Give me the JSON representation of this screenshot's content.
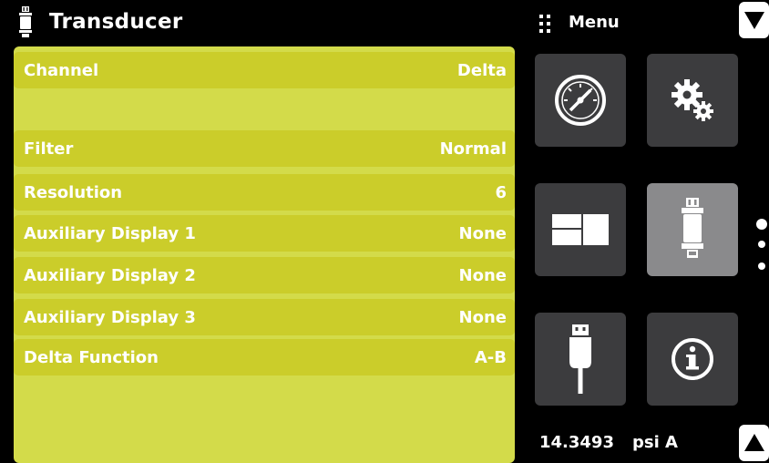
{
  "header": {
    "title": "Transducer",
    "icon": "transducer-icon"
  },
  "menu": {
    "label": "Menu",
    "icon": "grid-icon"
  },
  "settings": [
    {
      "label": "Channel",
      "value": "Delta"
    },
    {
      "label": "Filter",
      "value": "Normal"
    },
    {
      "label": "Resolution",
      "value": "6"
    },
    {
      "label": "Auxiliary Display 1",
      "value": "None"
    },
    {
      "label": "Auxiliary Display 2",
      "value": "None"
    },
    {
      "label": "Auxiliary Display 3",
      "value": "None"
    },
    {
      "label": "Delta Function",
      "value": "A-B"
    }
  ],
  "tiles": [
    {
      "name": "gauge-tile",
      "icon": "gauge-icon",
      "active": false
    },
    {
      "name": "settings-tile",
      "icon": "gears-icon",
      "active": false
    },
    {
      "name": "display-tile",
      "icon": "display-icon",
      "active": false
    },
    {
      "name": "transducer-tile",
      "icon": "transducer-icon",
      "active": true
    },
    {
      "name": "usb-tile",
      "icon": "usb-icon",
      "active": false
    },
    {
      "name": "info-tile",
      "icon": "info-icon",
      "active": false
    }
  ],
  "status": {
    "reading": "14.3493",
    "unit": "psi A"
  },
  "colors": {
    "panel": "#d3db4a",
    "row": "#cbcd2a",
    "tile": "#3c3c3e",
    "tile_active": "#8a8a8c"
  }
}
